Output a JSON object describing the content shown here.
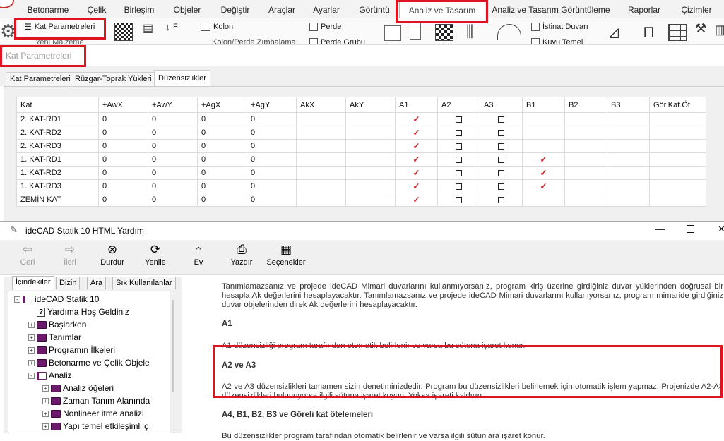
{
  "menu": [
    "Betonarme",
    "Çelik",
    "Birleşim",
    "Objeler",
    "Değiştir",
    "Araçlar",
    "Ayarlar",
    "Görüntü",
    "Analiz ve Tasarım",
    "Analiz ve Tasarım Görüntüleme",
    "Raporlar",
    "Çizimler"
  ],
  "ribbon": {
    "kat_parametreleri": "Kat Parametreleri",
    "yeni_malzeme": "Yeni Malzeme",
    "kolon": "Kolon",
    "kolon_perde": "Kolon/Perde Zımbalama",
    "perde": "Perde",
    "perde_grubu": "Perde Grubu",
    "istinat": "İstinat Duvarı",
    "kuyu": "Kuyu Temel",
    "f_label": "F"
  },
  "panel_title": "Kat Parametreleri",
  "tabs": [
    "Kat Parametreleri",
    "Rüzgar-Toprak Yükleri",
    "Düzensizlikler"
  ],
  "grid": {
    "headers": [
      "Kat",
      "+AwX",
      "+AwY",
      "+AgX",
      "+AgY",
      "AkX",
      "AkY",
      "A1",
      "A2",
      "A3",
      "B1",
      "B2",
      "B3",
      "Gör.Kat.Öt"
    ],
    "rows": [
      {
        "kat": "2. KAT-RD1",
        "v": [
          "0",
          "0",
          "0",
          "0"
        ],
        "a1": true,
        "b1": false
      },
      {
        "kat": "2. KAT-RD2",
        "v": [
          "0",
          "0",
          "0",
          "0"
        ],
        "a1": true,
        "b1": false
      },
      {
        "kat": "2. KAT-RD3",
        "v": [
          "0",
          "0",
          "0",
          "0"
        ],
        "a1": true,
        "b1": false
      },
      {
        "kat": "1. KAT-RD1",
        "v": [
          "0",
          "0",
          "0",
          "0"
        ],
        "a1": true,
        "b1": true
      },
      {
        "kat": "1. KAT-RD2",
        "v": [
          "0",
          "0",
          "0",
          "0"
        ],
        "a1": true,
        "b1": true
      },
      {
        "kat": "1. KAT-RD3",
        "v": [
          "0",
          "0",
          "0",
          "0"
        ],
        "a1": true,
        "b1": true
      },
      {
        "kat": "ZEMİN KAT",
        "v": [
          "0",
          "0",
          "0",
          "0"
        ],
        "a1": true,
        "b1": false
      }
    ]
  },
  "help": {
    "title": "ideCAD Statik 10 HTML Yardım",
    "toolbar": [
      "Geri",
      "İleri",
      "Durdur",
      "Yenile",
      "Ev",
      "Yazdır",
      "Seçenekler"
    ],
    "left_tabs": [
      "İçindekiler",
      "Dizin",
      "Ara",
      "Sık Kullanılanlar"
    ],
    "tree": [
      {
        "label": "ideCAD Statik 10",
        "type": "open",
        "level": 0,
        "exp": "-"
      },
      {
        "label": "Yardıma Hoş Geldiniz",
        "type": "page",
        "level": 1,
        "exp": ""
      },
      {
        "label": "Başlarken",
        "type": "book",
        "level": 1,
        "exp": "+"
      },
      {
        "label": "Tanımlar",
        "type": "book",
        "level": 1,
        "exp": "+"
      },
      {
        "label": "Programın İlkeleri",
        "type": "book",
        "level": 1,
        "exp": "+"
      },
      {
        "label": "Betonarme ve Çelik Objele",
        "type": "book",
        "level": 1,
        "exp": "+"
      },
      {
        "label": "Analiz",
        "type": "open",
        "level": 1,
        "exp": "-"
      },
      {
        "label": "Analiz öğeleri",
        "type": "book",
        "level": 2,
        "exp": "+"
      },
      {
        "label": "Zaman Tanım Alanında",
        "type": "book",
        "level": 2,
        "exp": "+"
      },
      {
        "label": "Nonlineer itme analizi",
        "type": "book",
        "level": 2,
        "exp": "+"
      },
      {
        "label": "Yapı temel etkileşimli ç",
        "type": "book",
        "level": 2,
        "exp": "+"
      }
    ],
    "content": {
      "p1": "Tanımlamazsanız ve projede ideCAD Mimari duvarlarını kullanmıyorsanız, program kiriş üzerine girdiğiniz duvar yüklerinden doğrusal bir hesapla Ak değerlerini hesaplayacaktır. Tanımlamazsanız ve projede ideCAD Mimari duvarlarını kullanıyorsanız, program mimaride girdiğiniz duvar objelerinden direk Ak değerlerini hesaplayacaktır.",
      "h_a1": "A1",
      "p_a1": "A1 düzensizliği program tarafından otomatik belirlenir ve varsa bu sütuna işaret konur.",
      "h_a2": "A2  ve A3",
      "p_a2": "A2 ve A3 düzensizlikleri tamamen sizin denetiminizdedir. Program bu düzensizlikleri belirlemek için otomatik işlem yapmaz. Projenizde A2-A3 düzensizlikleri bulunuyorsa ilgili sütuna işaret koyun. Yoksa işareti kaldırın.",
      "h_a4": "A4, B1, B2, B3 ve Göreli kat ötelemeleri",
      "p_a4": "Bu düzensizlikler program tarafından otomatik belirlenir ve varsa ilgili sütunlara işaret konur."
    }
  },
  "colors": {
    "highlight": "#e0141e",
    "check": "#d2191e",
    "book": "#6b1a6b"
  }
}
